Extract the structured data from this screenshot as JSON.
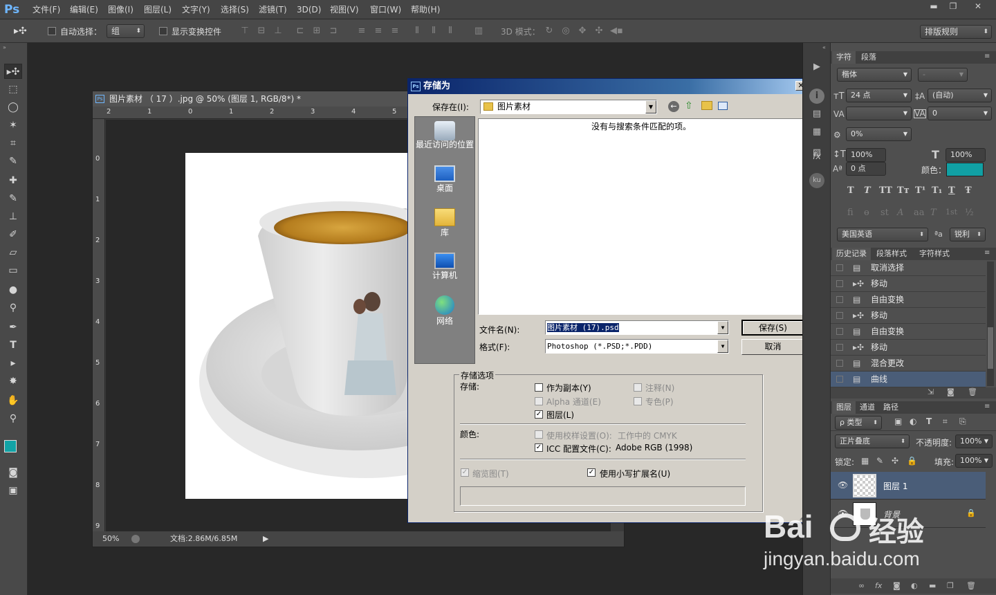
{
  "menubar": {
    "logo": "Ps",
    "items": [
      "文件(F)",
      "编辑(E)",
      "图像(I)",
      "图层(L)",
      "文字(Y)",
      "选择(S)",
      "滤镜(T)",
      "3D(D)",
      "视图(V)",
      "窗口(W)",
      "帮助(H)"
    ],
    "min": "▬",
    "restore": "❐",
    "close": "✕"
  },
  "options": {
    "auto_select_label": "自动选择：",
    "auto_select_value": "组",
    "show_transform_label": "显示变换控件",
    "mode3d_label": "3D 模式：",
    "workspace": "排版规则"
  },
  "doc": {
    "title": "图片素材 （ 17 ）.jpg @ 50% (图层 1, RGB/8*) *",
    "zoom": "50%",
    "doc_size": "文档:2.86M/6.85M",
    "ruler_top": [
      "2",
      "1",
      "0",
      "1",
      "2",
      "3",
      "4",
      "5"
    ],
    "ruler_left": [
      "0",
      "1",
      "2",
      "3",
      "4",
      "5",
      "6",
      "7",
      "8",
      "9"
    ]
  },
  "dialog": {
    "title": "存储为",
    "save_in_label": "保存在(I):",
    "save_in_value": "图片素材",
    "empty_message": "没有与搜索条件匹配的项。",
    "places": [
      "最近访问的位置",
      "桌面",
      "库",
      "计算机",
      "网络"
    ],
    "filename_label": "文件名(N):",
    "filename_value": "图片素材 (17).psd",
    "format_label": "格式(F):",
    "format_value": "Photoshop (*.PSD;*.PDD)",
    "save_button": "保存(S)",
    "cancel_button": "取消",
    "options_title": "存储选项",
    "save_label": "存储:",
    "as_copy": "作为副本(Y)",
    "notes": "注释(N)",
    "alpha": "Alpha 通道(E)",
    "spot": "专色(P)",
    "layers": "图层(L)",
    "color_label": "颜色:",
    "proof": "使用校样设置(O):",
    "proof_value": "工作中的 CMYK",
    "icc": "ICC 配置文件(C):",
    "icc_value": "Adobe RGB (1998)",
    "thumbnail": "缩览图(T)",
    "lowercase_ext": "使用小写扩展名(U)"
  },
  "char_panel": {
    "tabs": [
      "字符",
      "段落"
    ],
    "font_family": "楷体",
    "font_style": "-",
    "size": "24 点",
    "leading": "(自动)",
    "kerning": "",
    "tracking": "0",
    "scale_pct": "0%",
    "vscale": "100%",
    "hscale": "100%",
    "baseline": "0 点",
    "color_label": "颜色：",
    "color": "#11a0a4",
    "language": "美国英语",
    "aa_label": "ªa",
    "antialias": "锐利",
    "type_styles": [
      "T",
      "T",
      "TT",
      "Tт",
      "T¹",
      "T₁",
      "T",
      "Ŧ"
    ],
    "opentype": [
      "fi",
      "ɵ",
      "st",
      "A",
      "aa",
      "T",
      "1st",
      "½"
    ]
  },
  "history_panel": {
    "tabs": [
      "历史记录",
      "段落样式",
      "字符样式"
    ],
    "items": [
      {
        "label": "取消选择",
        "icon": "doc-icon"
      },
      {
        "label": "移动",
        "icon": "move-icon"
      },
      {
        "label": "自由变换",
        "icon": "doc-icon"
      },
      {
        "label": "移动",
        "icon": "move-icon"
      },
      {
        "label": "自由变换",
        "icon": "doc-icon"
      },
      {
        "label": "移动",
        "icon": "move-icon"
      },
      {
        "label": "混合更改",
        "icon": "doc-icon"
      },
      {
        "label": "曲线",
        "icon": "doc-icon"
      }
    ]
  },
  "layers_panel": {
    "tabs": [
      "图层",
      "通道",
      "路径"
    ],
    "filter": "ρ 类型",
    "blend": "正片叠底",
    "opacity_label": "不透明度:",
    "opacity": "100%",
    "lock_label": "锁定:",
    "fill_label": "填充:",
    "fill": "100%",
    "layers": [
      {
        "name": "图层 1"
      },
      {
        "name": "背景"
      }
    ]
  },
  "watermark": {
    "brand": "Bai",
    "brand2": "经验",
    "url": "jingyan.baidu.com"
  }
}
